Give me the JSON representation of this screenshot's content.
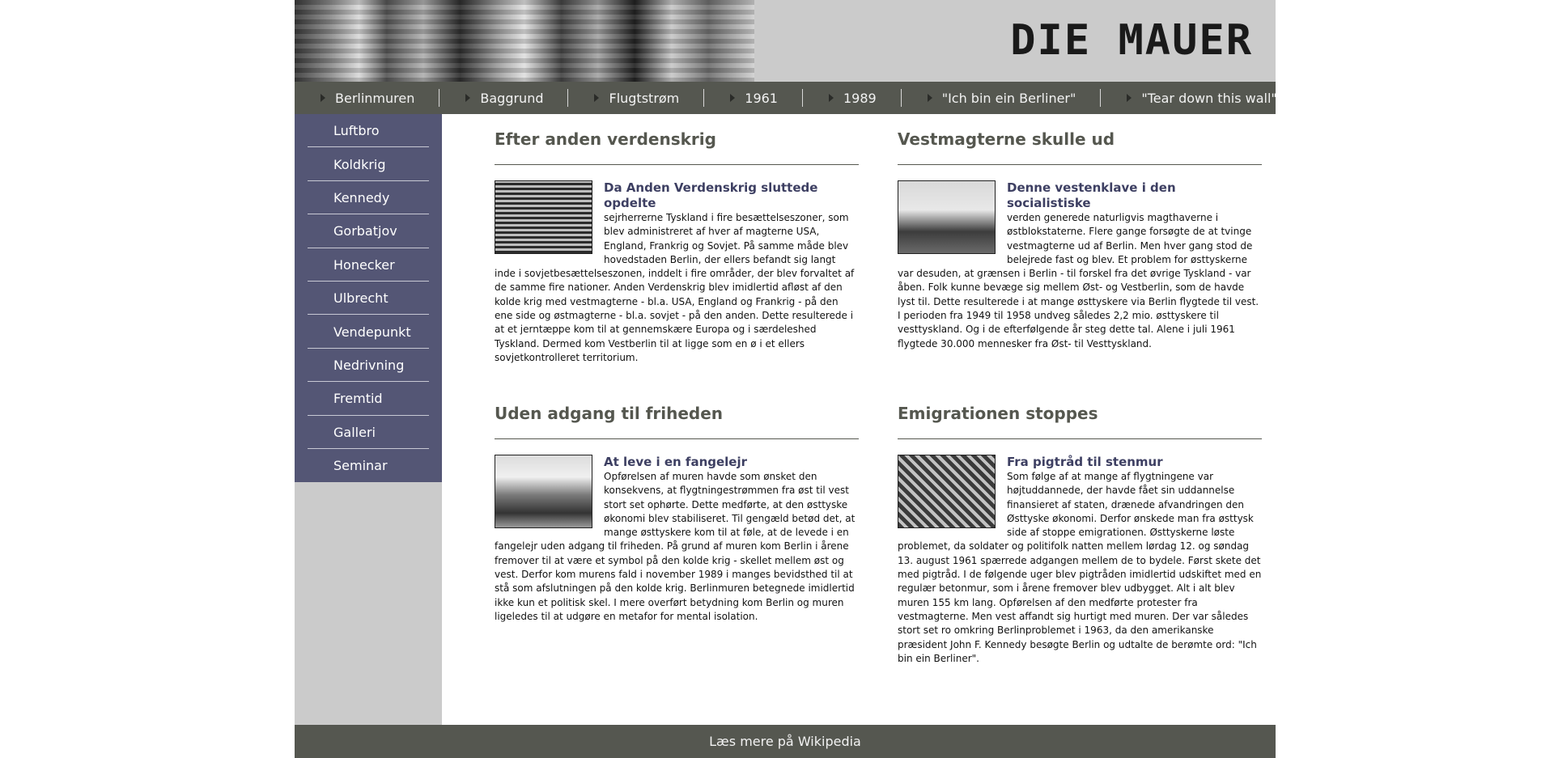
{
  "banner": {
    "logo_text": "DIE MAUER"
  },
  "topnav": {
    "items": [
      "Berlinmuren",
      "Baggrund",
      "Flugtstrøm",
      "1961",
      "1989",
      "\"Ich bin ein Berliner\"",
      "\"Tear down this wall\""
    ]
  },
  "sidenav": {
    "items": [
      "Luftbro",
      "Koldkrig",
      "Kennedy",
      "Gorbatjov",
      "Honecker",
      "Ulbrecht",
      "Vendepunkt",
      "Nedrivning",
      "Fremtid",
      "Galleri",
      "Seminar"
    ]
  },
  "articles": [
    {
      "heading": "Efter anden verdenskrig",
      "subheading": "Da Anden Verdenskrig sluttede opdelte",
      "body": "sejrherrerne Tyskland i fire besættelseszoner, som blev administreret af hver af magterne USA, England, Frankrig og Sovjet. På samme måde blev hovedstaden Berlin, der ellers befandt sig langt inde i sovjetbesættelseszonen, inddelt i fire områder, der blev forvaltet af de samme fire nationer. Anden Verdenskrig blev imidlertid afløst af den kolde krig med vestmagterne - bl.a. USA, England og Frankrig - på den ene side og østmagterne - bl.a. sovjet - på den anden. Dette resulterede i at et jerntæppe kom til at gennemskære Europa og i særdeleshed Tyskland. Dermed kom Vestberlin til at ligge som en ø i et ellers sovjetkontrolleret territorium."
    },
    {
      "heading": "Vestmagterne skulle ud",
      "subheading": "Denne vestenklave i den socialistiske",
      "body": "verden generede naturligvis magthaverne i østblokstaterne. Flere gange forsøgte de at tvinge vestmagterne ud af Berlin. Men hver gang stod de belejrede fast og blev. Et problem for østtyskerne var desuden, at grænsen i Berlin - til forskel fra det øvrige Tyskland - var åben. Folk kunne bevæge sig mellem Øst- og Vestberlin, som de havde lyst til. Dette resulterede i at mange østtyskere via Berlin flygtede til vest. I perioden fra 1949 til 1958 undveg således 2,2 mio. østtyskere til vesttyskland. Og i de efterfølgende år steg dette tal. Alene i juli 1961 flygtede 30.000 mennesker fra Øst- til Vesttyskland."
    },
    {
      "heading": "Uden adgang til friheden",
      "subheading": "At leve i en fangelejr",
      "body": "Opførelsen af muren havde som ønsket den konsekvens, at flygtningestrømmen fra øst til vest stort set ophørte. Dette medførte, at den østtyske økonomi blev stabiliseret. Til gengæld betød det, at mange østtyskere kom til at føle, at de levede i en fangelejr uden adgang til friheden. På grund af muren kom Berlin i årene fremover til at være et symbol på den kolde krig - skellet mellem øst og vest. Derfor kom murens fald i november 1989 i manges bevidsthed til at stå som afslutningen på den kolde krig. Berlinmuren betegnede imidlertid ikke kun et politisk skel. I mere overført betydning kom Berlin og muren ligeledes til at udgøre en metafor for mental isolation."
    },
    {
      "heading": "Emigrationen stoppes",
      "subheading": "Fra pigtråd til stenmur",
      "body": "Som følge af at mange af flygtningene var højtuddannede, der havde fået sin uddannelse finansieret af staten, drænede afvandringen den Østtyske økonomi. Derfor ønskede man fra østtysk side af stoppe emigrationen. Østtyskerne løste problemet, da soldater og politifolk natten mellem lørdag 12. og søndag 13. august 1961 spærrede adgangen mellem de to bydele. Først skete det med pigtråd. I de følgende uger blev pigtråden imidlertid udskiftet med en regulær betonmur, som i årene fremover blev udbygget. Alt i alt blev muren 155 km lang. Opførelsen af den medførte protester fra vestmagterne. Men vest affandt sig hurtigt med muren. Der var således stort set ro omkring Berlinproblemet i 1963, da den amerikanske præsident John F. Kennedy besøgte Berlin og udtalte de berømte ord: \"Ich bin ein Berliner\"."
    }
  ],
  "footer": {
    "link": "Læs mere på Wikipedia"
  }
}
